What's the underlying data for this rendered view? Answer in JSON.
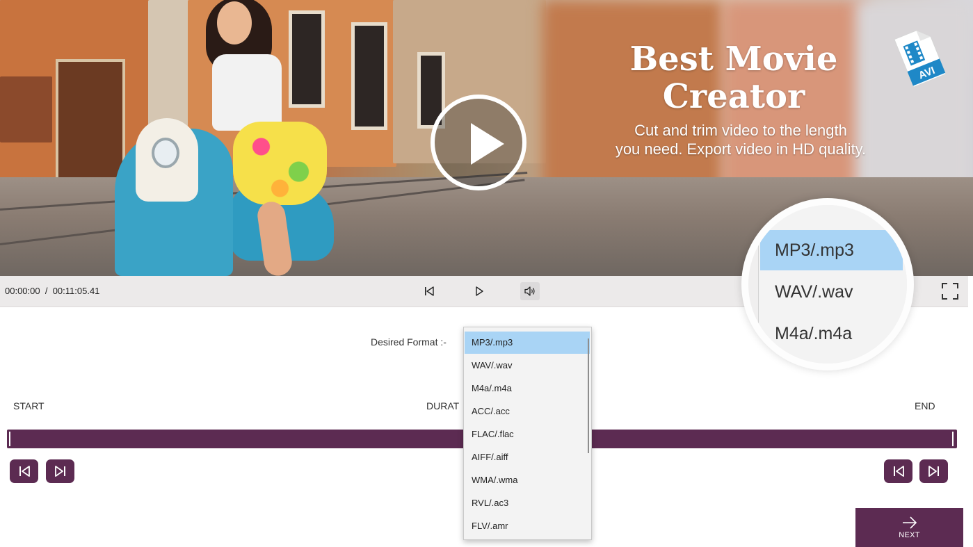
{
  "promo": {
    "title": "Best Movie\nCreator",
    "subtitle": "Cut and trim video to the length\nyou need. Export video in HD quality.",
    "badge_text": "AVI"
  },
  "player": {
    "current_time": "00:00:00",
    "separator": "/",
    "total_time": "00:11:05.41"
  },
  "editor": {
    "format_label": "Desired Format :-",
    "start_label": "START",
    "duration_label": "DURAT",
    "end_label": "END",
    "next_label": "NEXT"
  },
  "formats": {
    "options": [
      "MP3/.mp3",
      "WAV/.wav",
      "M4a/.m4a",
      "ACC/.acc",
      "FLAC/.flac",
      "AIFF/.aiff",
      "WMA/.wma",
      "RVL/.ac3",
      "FLV/.amr"
    ],
    "selected": "MP3/.mp3"
  },
  "magnifier": {
    "options": [
      "MP3/.mp3",
      "WAV/.wav",
      "M4a/.m4a"
    ]
  },
  "colors": {
    "accent": "#5c2b52",
    "selection": "#a9d4f5",
    "controls_bg": "#eceaea"
  },
  "icons": {
    "prev": "skip-back-icon",
    "play": "play-icon",
    "volume": "speaker-icon",
    "fullscreen": "fullscreen-icon",
    "next": "arrow-right-icon",
    "file": "avi-file-icon"
  }
}
